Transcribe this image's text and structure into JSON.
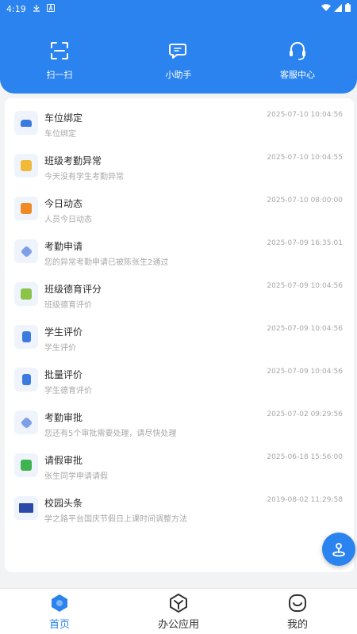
{
  "status_bar": {
    "time": "4:19"
  },
  "quick_actions": [
    {
      "label": "扫一扫",
      "icon": "scan-icon"
    },
    {
      "label": "小助手",
      "icon": "chat-icon"
    },
    {
      "label": "客服中心",
      "icon": "headset-icon"
    }
  ],
  "messages": [
    {
      "title": "车位绑定",
      "subtitle": "车位绑定",
      "time": "2025-07-10 10:04:56",
      "icon": "car-icon",
      "color": "#3b7be0"
    },
    {
      "title": "班级考勤异常",
      "subtitle": "今天没有学生考勤异常",
      "time": "2025-07-10 10:04:55",
      "icon": "attendance-warning-icon",
      "color": "#f0b93a"
    },
    {
      "title": "今日动态",
      "subtitle": "人员今日动态",
      "time": "2025-07-10 08:00:00",
      "icon": "activity-icon",
      "color": "#f08a24"
    },
    {
      "title": "考勤申请",
      "subtitle": "您的异常考勤申请已被陈张生2通过",
      "time": "2025-07-09 16:35:01",
      "icon": "cube-icon",
      "color": "#7f9fe8"
    },
    {
      "title": "班级德育评分",
      "subtitle": "班级德育评价",
      "time": "2025-07-09 10:04:56",
      "icon": "grade-icon",
      "color": "#8cc34a"
    },
    {
      "title": "学生评价",
      "subtitle": "学生评价",
      "time": "2025-07-09 10:04:56",
      "icon": "student-eval-icon",
      "color": "#3b7be0"
    },
    {
      "title": "批量评价",
      "subtitle": "学生德育评价",
      "time": "2025-07-09 10:04:56",
      "icon": "batch-eval-icon",
      "color": "#3b7be0"
    },
    {
      "title": "考勤审批",
      "subtitle": "您还有5个审批需要处理，请尽快处理",
      "time": "2025-07-02 09:29:56",
      "icon": "cube-icon",
      "color": "#7f9fe8"
    },
    {
      "title": "请假审批",
      "subtitle": "张生同学申请请假",
      "time": "2025-06-18 15:56:00",
      "icon": "leave-icon",
      "color": "#3fb34f"
    },
    {
      "title": "校园头条",
      "subtitle": "学之路平台国庆节假日上课时间调整方法",
      "time": "2019-08-02 11:29:58",
      "icon": "news-icon",
      "color": "#2b4aa8"
    }
  ],
  "bottom_nav": [
    {
      "label": "首页",
      "icon": "home-icon"
    },
    {
      "label": "办公应用",
      "icon": "office-apps-icon"
    },
    {
      "label": "我的",
      "icon": "profile-icon"
    }
  ],
  "colors": {
    "primary": "#2a83ee",
    "background": "#f2f3f5"
  }
}
